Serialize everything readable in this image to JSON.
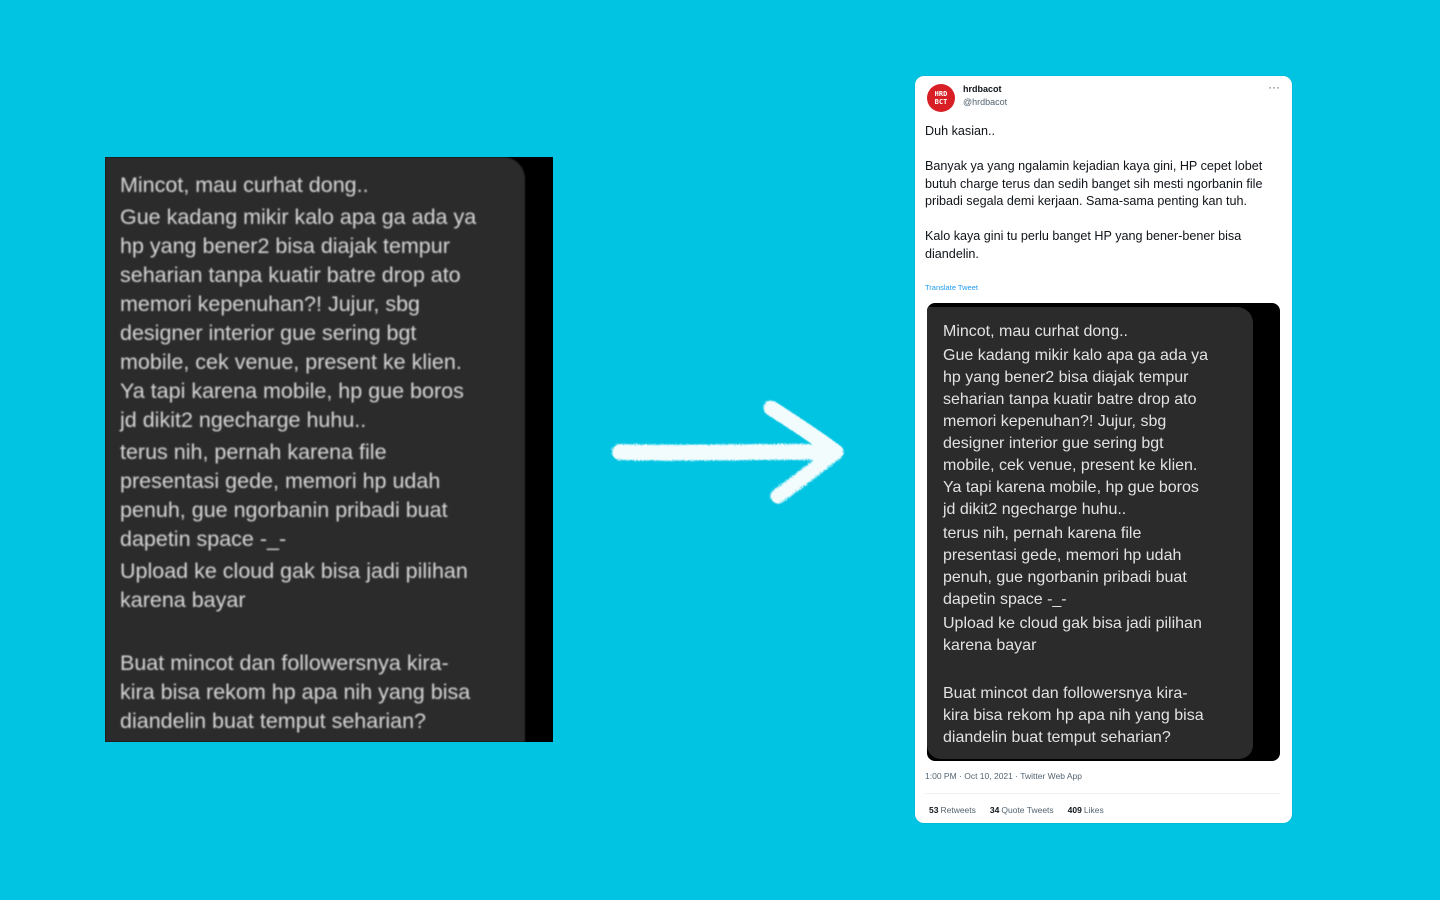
{
  "left_chat": {
    "messages": [
      "Mincot, mau curhat dong..",
      "Gue kadang mikir kalo apa ga ada ya\nhp yang bener2 bisa diajak tempur\nseharian tanpa kuatir batre drop ato\nmemori kepenuhan?! Jujur, sbg\ndesigner interior gue sering bgt\nmobile, cek venue, present ke klien.\nYa tapi karena mobile, hp gue boros\njd dikit2 ngecharge huhu..",
      "terus nih, pernah karena file\npresentasi gede, memori hp udah\npenuh, gue ngorbanin pribadi buat\ndapetin space -_-",
      "Upload ke cloud gak bisa jadi pilihan\nkarena bayar",
      "Buat mincot dan followersnya kira-\nkira bisa rekom hp apa nih yang bisa\ndiandelin buat temput seharian?"
    ]
  },
  "arrow": {
    "icon": "arrow-right-icon",
    "color": "#ffffff"
  },
  "tweet": {
    "avatar_line1": "HRD",
    "avatar_line2": "BCT",
    "username": "hrdbacot",
    "handle": "@hrdbacot",
    "more_label": "···",
    "text": "Duh kasian..\n\nBanyak ya yang ngalamin kejadian kaya gini, HP cepet lobet butuh charge terus dan sedih banget sih mesti ngorbanin file pribadi segala demi kerjaan. Sama-sama penting kan tuh.\n\nKalo kaya gini tu perlu banget HP yang bener-bener bisa diandelin.",
    "translate_label": "Translate Tweet",
    "media_messages": [
      "Mincot, mau curhat dong..",
      "Gue kadang mikir kalo apa ga ada ya\nhp yang bener2 bisa diajak tempur\nseharian tanpa kuatir batre drop ato\nmemori kepenuhan?! Jujur, sbg\ndesigner interior gue sering bgt\nmobile, cek venue, present ke klien.\nYa tapi karena mobile, hp gue boros\njd dikit2 ngecharge huhu..",
      "terus nih, pernah karena file\npresentasi gede, memori hp udah\npenuh, gue ngorbanin pribadi buat\ndapetin space -_-",
      "Upload ke cloud gak bisa jadi pilihan\nkarena bayar",
      "Buat mincot dan followersnya kira-\nkira bisa rekom hp apa nih yang bisa\ndiandelin buat temput seharian?"
    ],
    "meta": "1:00 PM · Oct 10, 2021 · Twitter Web App",
    "stats": {
      "retweets_count": "53",
      "retweets_label": "Retweets",
      "quotes_count": "34",
      "quotes_label": "Quote Tweets",
      "likes_count": "409",
      "likes_label": "Likes"
    }
  },
  "colors": {
    "background": "#00c4e2",
    "bubble": "#2b2b2b",
    "avatar": "#d81f26",
    "link": "#1d9bf0"
  }
}
